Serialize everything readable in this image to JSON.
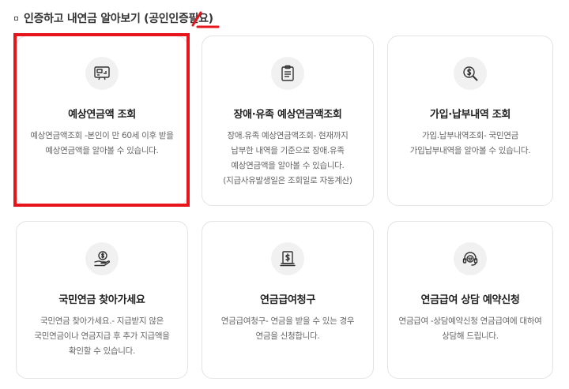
{
  "section": {
    "title": "인증하고 내연금 알아보기 (공인인증필요)"
  },
  "cards": [
    {
      "title": "예상연금액 조회",
      "desc": "예상연금액조회 -본인이 만 60세 이후 받을\n예상연금액을 알아볼 수 있습니다.",
      "icon": "monitor-chart-icon"
    },
    {
      "title": "장애·유족 예상연금액조회",
      "desc": "장애.유족 예상연금액조회- 현재까지\n납부한 내역을 기준으로 장애.유족\n예상연금액을 알아볼 수 있습니다.\n(지급사유발생일은 조회일로 자동계산)",
      "icon": "clipboard-icon"
    },
    {
      "title": "가입·납부내역 조회",
      "desc": "가입.납부내역조회- 국민연금\n가입납부내역을 알아볼 수 있습니다.",
      "icon": "dollar-search-icon"
    },
    {
      "title": "국민연금 찾아가세요",
      "desc": "국민연금 찾아가세요.- 지급받지 않은\n국민연금이나 연금지급 후 추가 지급액을\n확인할 수 있습니다.",
      "icon": "hand-coin-icon"
    },
    {
      "title": "연금급여청구",
      "desc": "연금급여청구- 연금을 받을 수 있는 경우\n연금을 신청합니다.",
      "icon": "pension-claim-icon"
    },
    {
      "title": "연금급여 상담 예약신청",
      "desc": "연금급여 -상담예약신청 연금급여에 대하여\n상담해 드립니다.",
      "icon": "headset-icon"
    }
  ],
  "colors": {
    "highlight": "#e8141b",
    "card_border": "#e3e3e3",
    "icon_bg": "#f1f1f1"
  }
}
